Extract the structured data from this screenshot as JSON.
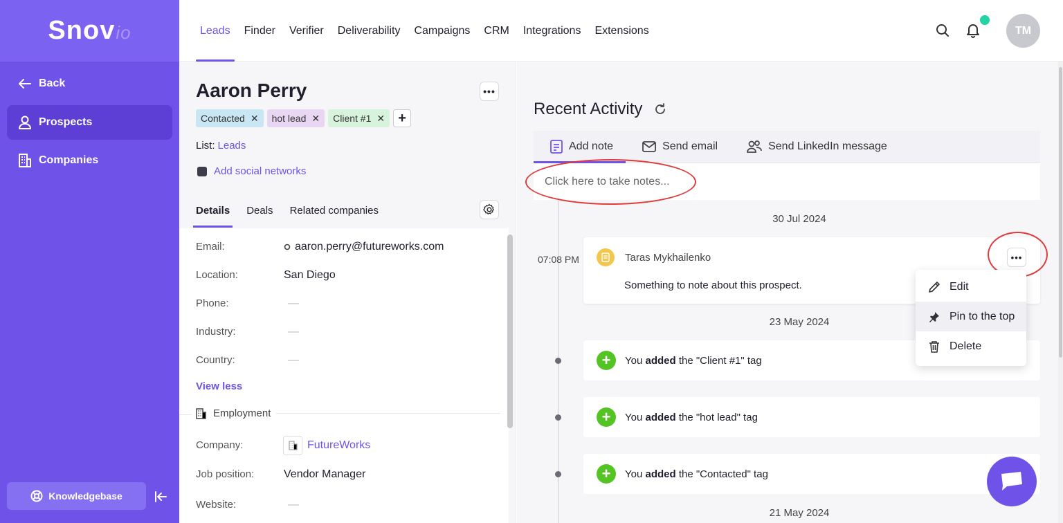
{
  "brand": {
    "name": "Snov",
    "suffix": "io"
  },
  "sidebar": {
    "back_label": "Back",
    "items": [
      {
        "label": "Prospects",
        "active": true
      },
      {
        "label": "Companies",
        "active": false
      }
    ],
    "knowledgebase_label": "Knowledgebase"
  },
  "topnav": {
    "items": [
      "Leads",
      "Finder",
      "Verifier",
      "Deliverability",
      "Campaigns",
      "CRM",
      "Integrations",
      "Extensions"
    ],
    "active": "Leads",
    "avatar_initials": "TM"
  },
  "prospect": {
    "name": "Aaron Perry",
    "tags": [
      {
        "label": "Contacted",
        "color": "#c9e6f5"
      },
      {
        "label": "hot lead",
        "color": "#e9d6f3"
      },
      {
        "label": "Client #1",
        "color": "#d7f3dc"
      }
    ],
    "list_label": "List:",
    "list_value": "Leads",
    "add_social_label": "Add social networks",
    "tabs": [
      "Details",
      "Deals",
      "Related companies"
    ],
    "active_tab": "Details",
    "details": {
      "email_label": "Email:",
      "email_value": "aaron.perry@futureworks.com",
      "location_label": "Location:",
      "location_value": "San Diego",
      "phone_label": "Phone:",
      "phone_value": "—",
      "industry_label": "Industry:",
      "industry_value": "—",
      "country_label": "Country:",
      "country_value": "—",
      "view_less": "View less"
    },
    "employment": {
      "heading": "Employment",
      "company_label": "Company:",
      "company_value": "FutureWorks",
      "job_label": "Job position:",
      "job_value": "Vendor Manager",
      "website_label": "Website:",
      "website_value": "—"
    }
  },
  "activity": {
    "title": "Recent Activity",
    "composer_tabs": [
      "Add note",
      "Send email",
      "Send LinkedIn message"
    ],
    "active_composer_tab": "Add note",
    "note_placeholder": "Click here to take notes...",
    "dates": [
      "30 Jul 2024",
      "23 May 2024",
      "21 May 2024"
    ],
    "note": {
      "time": "07:08 PM",
      "author": "Taras Mykhailenko",
      "body": "Something to note about this prospect."
    },
    "events": [
      {
        "pre": "You ",
        "verb": "added",
        "post": " the \"Client #1\" tag"
      },
      {
        "pre": "You ",
        "verb": "added",
        "post": " the \"hot lead\" tag"
      },
      {
        "pre": "You ",
        "verb": "added",
        "post": " the \"Contacted\" tag"
      }
    ],
    "menu": {
      "items": [
        "Edit",
        "Pin to the top",
        "Delete"
      ],
      "hovered": "Pin to the top"
    }
  },
  "colors": {
    "accent": "#6f53e8",
    "sidebar": "#6f53e8",
    "success": "#54c424",
    "highlight": "#e03b3b"
  }
}
